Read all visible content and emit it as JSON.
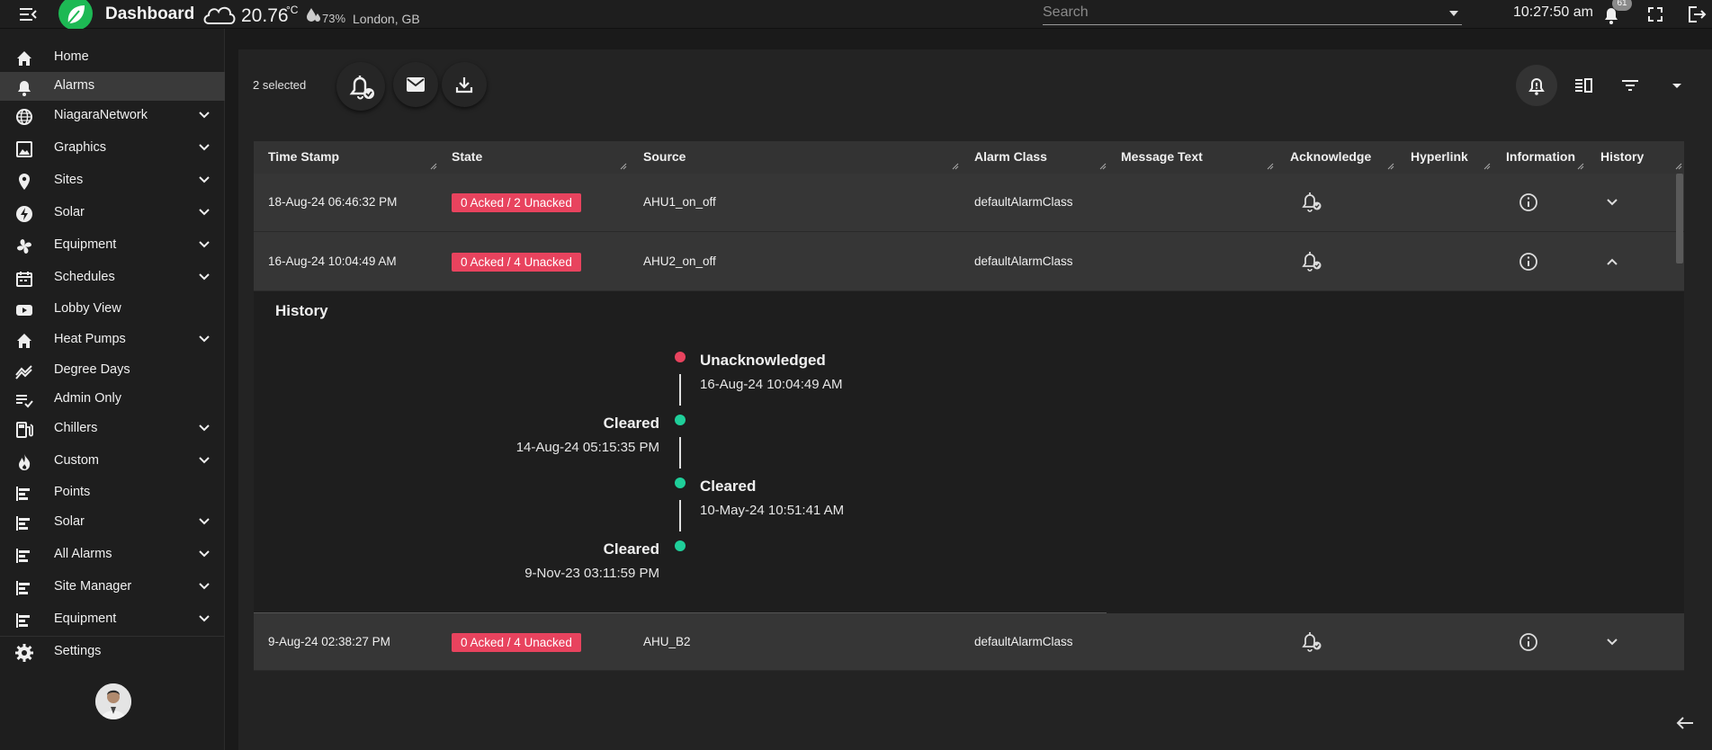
{
  "header": {
    "title": "Dashboard",
    "temperature": "20.76",
    "temperature_unit": "°C",
    "humidity": "73%",
    "location": "London, GB",
    "search_placeholder": "Search",
    "time": "10:27:50 am",
    "notification_count": "61",
    "brand_color": "#1db954"
  },
  "sidebar": {
    "items": [
      {
        "label": "Home",
        "icon": "home-icon",
        "expandable": false,
        "active": false
      },
      {
        "label": "Alarms",
        "icon": "bell-icon",
        "expandable": false,
        "active": true
      },
      {
        "label": "NiagaraNetwork",
        "icon": "globe-icon",
        "expandable": true
      },
      {
        "label": "Graphics",
        "icon": "image-icon",
        "expandable": true
      },
      {
        "label": "Sites",
        "icon": "location-pin-icon",
        "expandable": true
      },
      {
        "label": "Solar",
        "icon": "bolt-icon",
        "expandable": true
      },
      {
        "label": "Equipment",
        "icon": "fan-icon",
        "expandable": true
      },
      {
        "label": "Schedules",
        "icon": "calendar-icon",
        "expandable": true
      },
      {
        "label": "Lobby View",
        "icon": "youtube-icon",
        "expandable": false
      },
      {
        "label": "Heat Pumps",
        "icon": "home-icon",
        "expandable": true
      },
      {
        "label": "Degree Days",
        "icon": "trend-icon",
        "expandable": false
      },
      {
        "label": "Admin Only",
        "icon": "playlist-check-icon",
        "expandable": false
      },
      {
        "label": "Chillers",
        "icon": "fuel-icon",
        "expandable": true
      },
      {
        "label": "Custom",
        "icon": "flame-icon",
        "expandable": true
      },
      {
        "label": "Points",
        "icon": "bars-icon",
        "expandable": false
      },
      {
        "label": "Solar",
        "icon": "bars-icon",
        "expandable": true
      },
      {
        "label": "All Alarms",
        "icon": "bars-icon",
        "expandable": true
      },
      {
        "label": "Site Manager",
        "icon": "bars-icon",
        "expandable": true
      },
      {
        "label": "Equipment",
        "icon": "bars-icon",
        "expandable": true
      },
      {
        "label": "Settings",
        "icon": "gear-icon",
        "expandable": false
      }
    ]
  },
  "toolbar": {
    "selected_text": "2 selected",
    "buttons": [
      "acknowledge-icon",
      "mail-icon",
      "download-icon"
    ],
    "right_buttons": [
      "bell-alert-icon",
      "columns-icon",
      "filter-icon",
      "caret-down-icon"
    ]
  },
  "table": {
    "columns": [
      "Time Stamp",
      "State",
      "Source",
      "Alarm Class",
      "Message Text",
      "Acknowledge",
      "Hyperlink",
      "Information",
      "History"
    ],
    "rows": [
      {
        "timestamp": "18-Aug-24 06:46:32 PM",
        "state": "0 Acked / 2 Unacked",
        "source": "AHU1_on_off",
        "alarm_class": "defaultAlarmClass",
        "message": "",
        "expanded": false
      },
      {
        "timestamp": "16-Aug-24 10:04:49 AM",
        "state": "0 Acked / 4 Unacked",
        "source": "AHU2_on_off",
        "alarm_class": "defaultAlarmClass",
        "message": "",
        "expanded": true
      },
      {
        "timestamp": "9-Aug-24 02:38:27 PM",
        "state": "0 Acked / 4 Unacked",
        "source": "AHU_B2",
        "alarm_class": "defaultAlarmClass",
        "message": "",
        "expanded": false
      }
    ],
    "state_color": "#e8435e"
  },
  "history": {
    "title": "History",
    "events": [
      {
        "status": "Unacknowledged",
        "timestamp": "16-Aug-24 10:04:49 AM",
        "color": "#e8435e",
        "side": "right"
      },
      {
        "status": "Cleared",
        "timestamp": "14-Aug-24 05:15:35 PM",
        "color": "#1fcf9a",
        "side": "left"
      },
      {
        "status": "Cleared",
        "timestamp": "10-May-24 10:51:41 AM",
        "color": "#1fcf9a",
        "side": "right"
      },
      {
        "status": "Cleared",
        "timestamp": "9-Nov-23 03:11:59 PM",
        "color": "#1fcf9a",
        "side": "left"
      }
    ]
  }
}
